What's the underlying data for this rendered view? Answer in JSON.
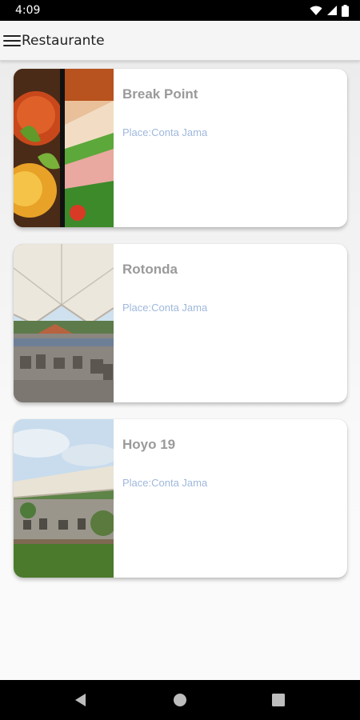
{
  "status_bar": {
    "time": "4:09",
    "icons": [
      "wifi-icon",
      "signal-icon",
      "battery-icon"
    ]
  },
  "app_bar": {
    "title": "Restaurante",
    "menu_icon": "hamburger-menu-icon"
  },
  "restaurants": [
    {
      "name": "Break Point",
      "place": "Place:Conta Jama",
      "image": "food-photo"
    },
    {
      "name": "Rotonda",
      "place": "Place:Conta Jama",
      "image": "tent-terrace-photo"
    },
    {
      "name": "Hoyo 19",
      "place": "Place:Conta Jama",
      "image": "outdoor-tent-photo"
    }
  ],
  "nav_bar": {
    "icons": [
      "back-icon",
      "home-icon",
      "recents-icon"
    ]
  },
  "colors": {
    "title_text": "#9a9a9a",
    "place_text": "#9fb8dc",
    "app_bar_bg": "#f5f5f5"
  }
}
